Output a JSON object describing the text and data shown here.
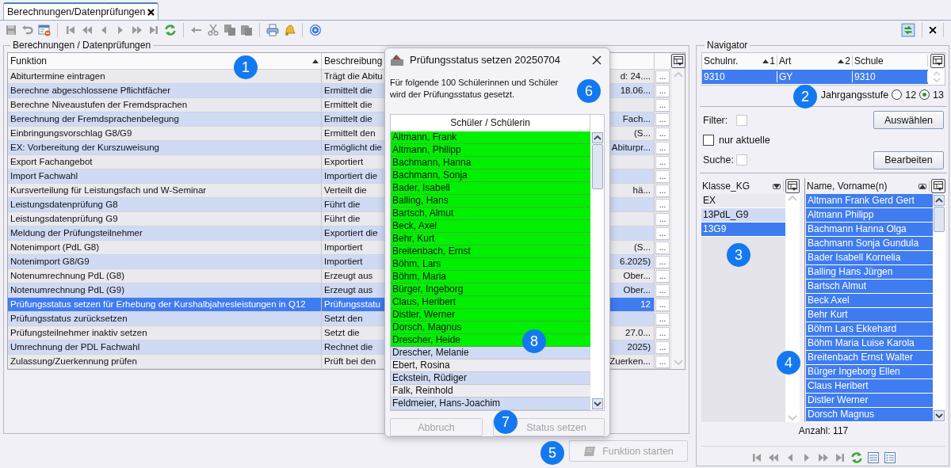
{
  "tab": {
    "label": "Berechnungen/Datenprüfungen"
  },
  "group_title": "Berechnungen / Datenprüfungen",
  "table": {
    "columns": [
      "Funktion",
      "Beschreibung"
    ],
    "rows": [
      {
        "function": "Abiturtermine eintragen",
        "desc_start": "Trägt die Abitu",
        "desc_end": "d: 24....",
        "action": "...",
        "selected": false
      },
      {
        "function": "Berechne abgeschlossene Pflichtfächer",
        "desc_start": "Ermittelt die",
        "desc_end": "18.06...",
        "action": "...",
        "selected": false
      },
      {
        "function": "Berechne Niveaustufen der Fremdsprachen",
        "desc_start": "Ermittelt die",
        "action": "...",
        "selected": false
      },
      {
        "function": "Berechnung der Fremdsprachenbelegung",
        "desc_start": "Ermittelt die",
        "desc_end": "Fach...",
        "action": "...",
        "selected": false
      },
      {
        "function": "Einbringungsvorschlag G8/G9",
        "desc_start": "Ermittelt den",
        "desc_end": "(S...",
        "action": "...",
        "selected": false
      },
      {
        "function": "EX: Vorbereitung der Kurszuweisung",
        "desc_start": "Ermöglicht die",
        "desc_end": "Abiturpr...",
        "action": "...",
        "selected": false
      },
      {
        "function": "Export Fachangebot",
        "desc_start": "Exportiert",
        "action": "...",
        "selected": false
      },
      {
        "function": "Import Fachwahl",
        "desc_start": "Importiert die",
        "action": "...",
        "selected": false
      },
      {
        "function": "Kursverteilung für Leistungsfach und W-Seminar",
        "desc_start": "Verteilt die",
        "desc_end": "hä...",
        "action": "...",
        "selected": false
      },
      {
        "function": "Leistungsdatenprüfung G8",
        "desc_start": "Führt die",
        "action": "...",
        "selected": false
      },
      {
        "function": "Leistungsdatenprüfung G9",
        "desc_start": "Führt die",
        "action": "...",
        "selected": false
      },
      {
        "function": "Meldung der Prüfungsteilnehmer",
        "desc_start": "Exportiert die",
        "action": "...",
        "selected": false
      },
      {
        "function": "Notenimport (PdL G8)",
        "desc_start": "Importiert",
        "desc_end": "(S...",
        "action": "...",
        "selected": false
      },
      {
        "function": "Notenimport G8/G9",
        "desc_start": "Importiert",
        "desc_end": "6.2025)",
        "action": "...",
        "selected": false
      },
      {
        "function": "Notenumrechnung PdL (G8)",
        "desc_start": "Erzeugt aus",
        "desc_end": "Ober...",
        "action": "...",
        "selected": false
      },
      {
        "function": "Notenumrechnung PdL (G9)",
        "desc_start": "Erzeugt aus",
        "desc_end": "Ober...",
        "action": "...",
        "selected": false
      },
      {
        "function": "Prüfungsstatus setzen für Erhebung der Kurshalbjahresleistungen in Q12",
        "desc_start": "Prüfungsstatu",
        "desc_end": "12",
        "action": "...",
        "selected": true
      },
      {
        "function": "Prüfungsstatus zurücksetzen",
        "desc_start": "Setzt den",
        "action": "...",
        "selected": false
      },
      {
        "function": "Prüfungsteilnehmer inaktiv setzen",
        "desc_start": "Setzt die",
        "desc_end": "27.0...",
        "action": "...",
        "selected": false
      },
      {
        "function": "Umrechnung der PDL Fachwahl",
        "desc_start": "Rechnet die",
        "desc_end": "2025)",
        "action": "...",
        "selected": false
      },
      {
        "function": "Zulassung/Zuerkennung prüfen",
        "desc_start": "Prüft bei den",
        "desc_end": "Zuerken...",
        "action": "...",
        "selected": false
      }
    ]
  },
  "start_button": {
    "label": "Funktion starten",
    "disabled": true
  },
  "dialog": {
    "title": "Prüfungsstatus setzen 20250704",
    "message": "Für folgende 100 Schülerinnen und Schüler wird der Prüfungsstatus gesetzt.",
    "list_header": "Schüler / Schülerin",
    "students": [
      {
        "name": "Altmann, Frank",
        "highlighted": true
      },
      {
        "name": "Altmann, Philipp",
        "highlighted": true
      },
      {
        "name": "Bachmann, Hanna",
        "highlighted": true
      },
      {
        "name": "Bachmann, Sonja",
        "highlighted": true
      },
      {
        "name": "Bader, Isabell",
        "highlighted": true
      },
      {
        "name": "Balling, Hans",
        "highlighted": true
      },
      {
        "name": "Bartsch, Almut",
        "highlighted": true
      },
      {
        "name": "Beck, Axel",
        "highlighted": true
      },
      {
        "name": "Behr, Kurt",
        "highlighted": true
      },
      {
        "name": "Breitenbach, Ernst",
        "highlighted": true
      },
      {
        "name": "Böhm, Lars",
        "highlighted": true
      },
      {
        "name": "Böhm, Maria",
        "highlighted": true
      },
      {
        "name": "Bürger, Ingeborg",
        "highlighted": true
      },
      {
        "name": "Claus, Heribert",
        "highlighted": true
      },
      {
        "name": "Distler, Werner",
        "highlighted": true
      },
      {
        "name": "Dorsch, Magnus",
        "highlighted": true
      },
      {
        "name": "Drescher, Heide",
        "highlighted": true
      },
      {
        "name": "Drescher, Melanie",
        "highlighted": false
      },
      {
        "name": "Ebert, Rosina",
        "highlighted": false
      },
      {
        "name": "Eckstein, Rüdiger",
        "highlighted": false
      },
      {
        "name": "Falk, Reinhold",
        "highlighted": false
      },
      {
        "name": "Feldmeier, Hans-Joachim",
        "highlighted": false
      }
    ],
    "buttons": [
      {
        "label": "Abbruch",
        "disabled": true
      },
      {
        "label": "Status setzen",
        "disabled": true
      }
    ]
  },
  "navigator": {
    "title": "Navigator",
    "school_table": {
      "columns": [
        {
          "label": "Schulnr.",
          "sort": "1"
        },
        {
          "label": "Art",
          "sort": "2"
        },
        {
          "label": "Schule"
        }
      ],
      "rows": [
        {
          "cells": [
            "9310",
            "GY",
            "9310"
          ],
          "selected": true
        }
      ]
    },
    "grade": {
      "label": "Jahrgangsstufe",
      "options": [
        {
          "label": "12",
          "selected": false
        },
        {
          "label": "13",
          "selected": true
        }
      ]
    },
    "filter": {
      "label": "Filter:",
      "checked": false
    },
    "select_button": "Auswählen",
    "current_only": {
      "label": "nur aktuelle",
      "checked": false
    },
    "search": {
      "label": "Suche:",
      "checked": false
    },
    "edit_button": "Bearbeiten",
    "classes": {
      "header": "Klasse_KG",
      "items": [
        {
          "label": "EX",
          "selected": false
        },
        {
          "label": "13PdL_G9",
          "selected": false
        },
        {
          "label": "13G9",
          "selected": true
        }
      ]
    },
    "names": {
      "header": "Name, Vorname(n)",
      "items": [
        {
          "label": "Altmann Frank Gerd Gert",
          "selected": true
        },
        {
          "label": "Altmann Philipp",
          "selected": true
        },
        {
          "label": "Bachmann Hanna Olga",
          "selected": true
        },
        {
          "label": "Bachmann Sonja Gundula",
          "selected": true
        },
        {
          "label": "Bader Isabell Kornelia",
          "selected": true
        },
        {
          "label": "Balling Hans Jürgen",
          "selected": true
        },
        {
          "label": "Bartsch Almut",
          "selected": true
        },
        {
          "label": "Beck Axel",
          "selected": true
        },
        {
          "label": "Behr Kurt",
          "selected": true
        },
        {
          "label": "Böhm Lars Ekkehard",
          "selected": true
        },
        {
          "label": "Böhm Maria Luise Karola",
          "selected": true
        },
        {
          "label": "Breitenbach Ernst Walter",
          "selected": true
        },
        {
          "label": "Bürger Ingeborg Ellen",
          "selected": true
        },
        {
          "label": "Claus Heribert",
          "selected": true
        },
        {
          "label": "Distler Werner",
          "selected": true
        },
        {
          "label": "Dorsch Magnus",
          "selected": true
        }
      ]
    },
    "count": "Anzahl: 117"
  },
  "callouts": [
    "1",
    "2",
    "3",
    "4",
    "5",
    "6",
    "7",
    "8"
  ]
}
